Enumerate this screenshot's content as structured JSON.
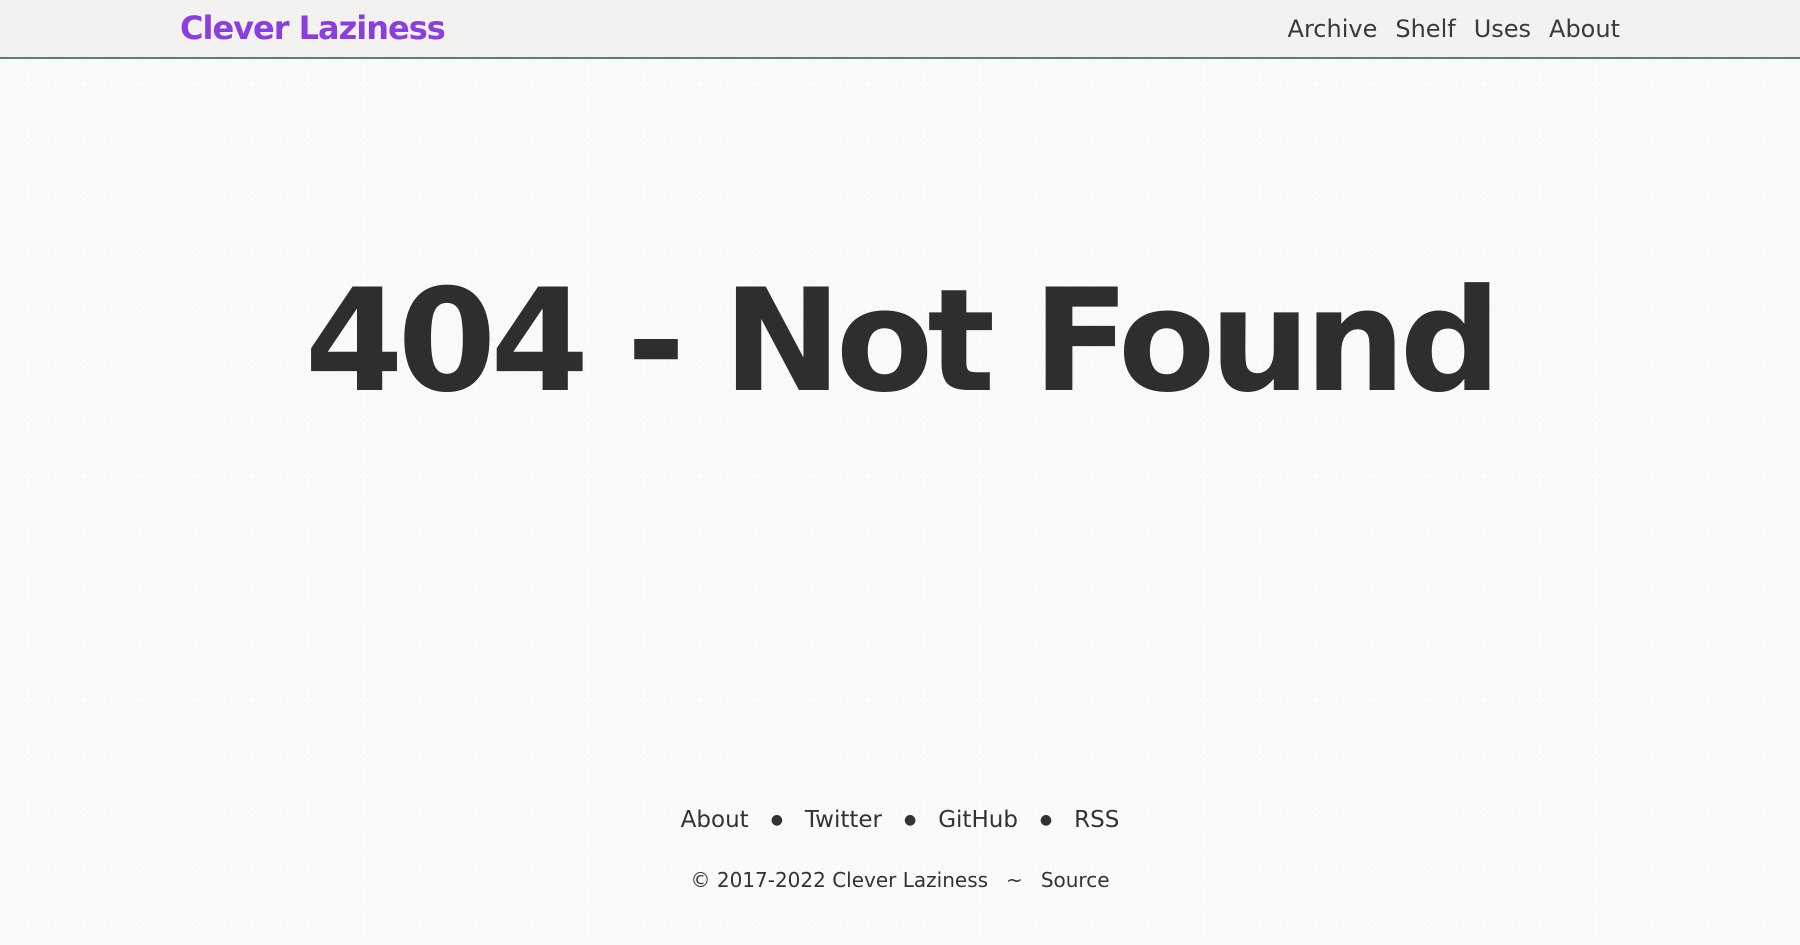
{
  "header": {
    "brand": "Clever Laziness",
    "brand_color": "#8a3ee0",
    "nav": [
      {
        "label": "Archive"
      },
      {
        "label": "Shelf"
      },
      {
        "label": "Uses"
      },
      {
        "label": "About"
      }
    ]
  },
  "main": {
    "title": "404 - Not Found"
  },
  "footer": {
    "links": [
      {
        "label": "About"
      },
      {
        "label": "Twitter"
      },
      {
        "label": "GitHub"
      },
      {
        "label": "RSS"
      }
    ],
    "separator": "●",
    "copyright": "© 2017-2022 Clever Laziness",
    "tilde": "~",
    "source_label": "Source"
  }
}
